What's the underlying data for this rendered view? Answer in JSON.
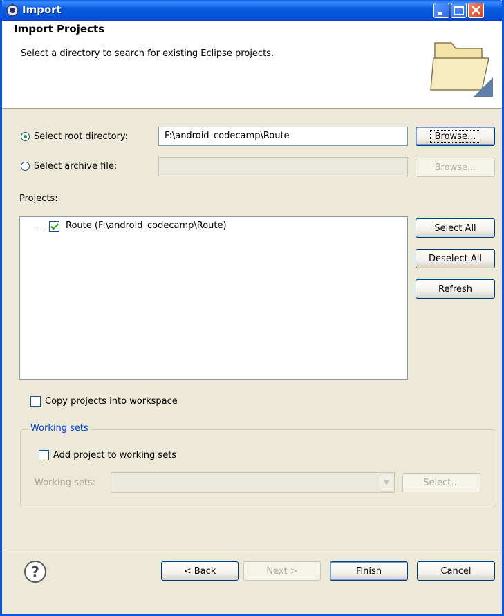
{
  "window": {
    "title": "Import",
    "controls": {
      "minimize": "minimize",
      "maximize": "maximize",
      "close": "close"
    }
  },
  "header": {
    "title": "Import Projects",
    "description": "Select a directory to search for existing Eclipse projects."
  },
  "root_directory": {
    "label": "Select root directory:",
    "value": "F:\\android_codecamp\\Route",
    "browse": "Browse...",
    "selected": true
  },
  "archive_file": {
    "label": "Select archive file:",
    "value": "",
    "browse": "Browse...",
    "selected": false
  },
  "projects": {
    "label": "Projects:",
    "items": [
      {
        "label": "Route (F:\\android_codecamp\\Route)",
        "checked": true
      }
    ],
    "select_all": "Select All",
    "deselect_all": "Deselect All",
    "refresh": "Refresh"
  },
  "copy_projects": {
    "label": "Copy projects into workspace",
    "checked": false
  },
  "working_sets": {
    "group_title": "Working sets",
    "add_label": "Add project to working sets",
    "add_checked": false,
    "field_label": "Working sets:",
    "field_value": "",
    "select_button": "Select..."
  },
  "footer": {
    "help": "?",
    "back": "< Back",
    "next": "Next >",
    "finish": "Finish",
    "cancel": "Cancel"
  }
}
